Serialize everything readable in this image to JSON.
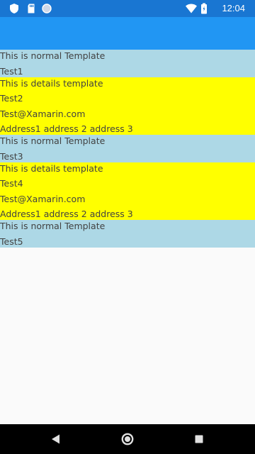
{
  "status_bar": {
    "time": "12:04",
    "left_icons": [
      "shield-icon",
      "sd-card-icon",
      "sync-circle-icon"
    ],
    "right_icons": [
      "wifi-icon",
      "battery-icon"
    ]
  },
  "app_bar": {
    "color": "#2196f3"
  },
  "colors": {
    "normal_row": "#add8e6",
    "details_row": "#ffff00",
    "status_bar": "#1976d2"
  },
  "list": {
    "items": [
      {
        "template": "normal",
        "heading": "This is normal Template",
        "name": "Test1"
      },
      {
        "template": "details",
        "heading": "This is details template",
        "name": "Test2",
        "email": "Test@Xamarin.com",
        "address": "Address1 address 2 address 3"
      },
      {
        "template": "normal",
        "heading": "This is normal Template",
        "name": "Test3"
      },
      {
        "template": "details",
        "heading": "This is details template",
        "name": "Test4",
        "email": "Test@Xamarin.com",
        "address": "Address1 address 2 address 3"
      },
      {
        "template": "normal",
        "heading": "This is normal Template",
        "name": "Test5"
      }
    ]
  },
  "nav_bar": {
    "buttons": [
      "back-icon",
      "home-icon",
      "recents-icon"
    ]
  }
}
